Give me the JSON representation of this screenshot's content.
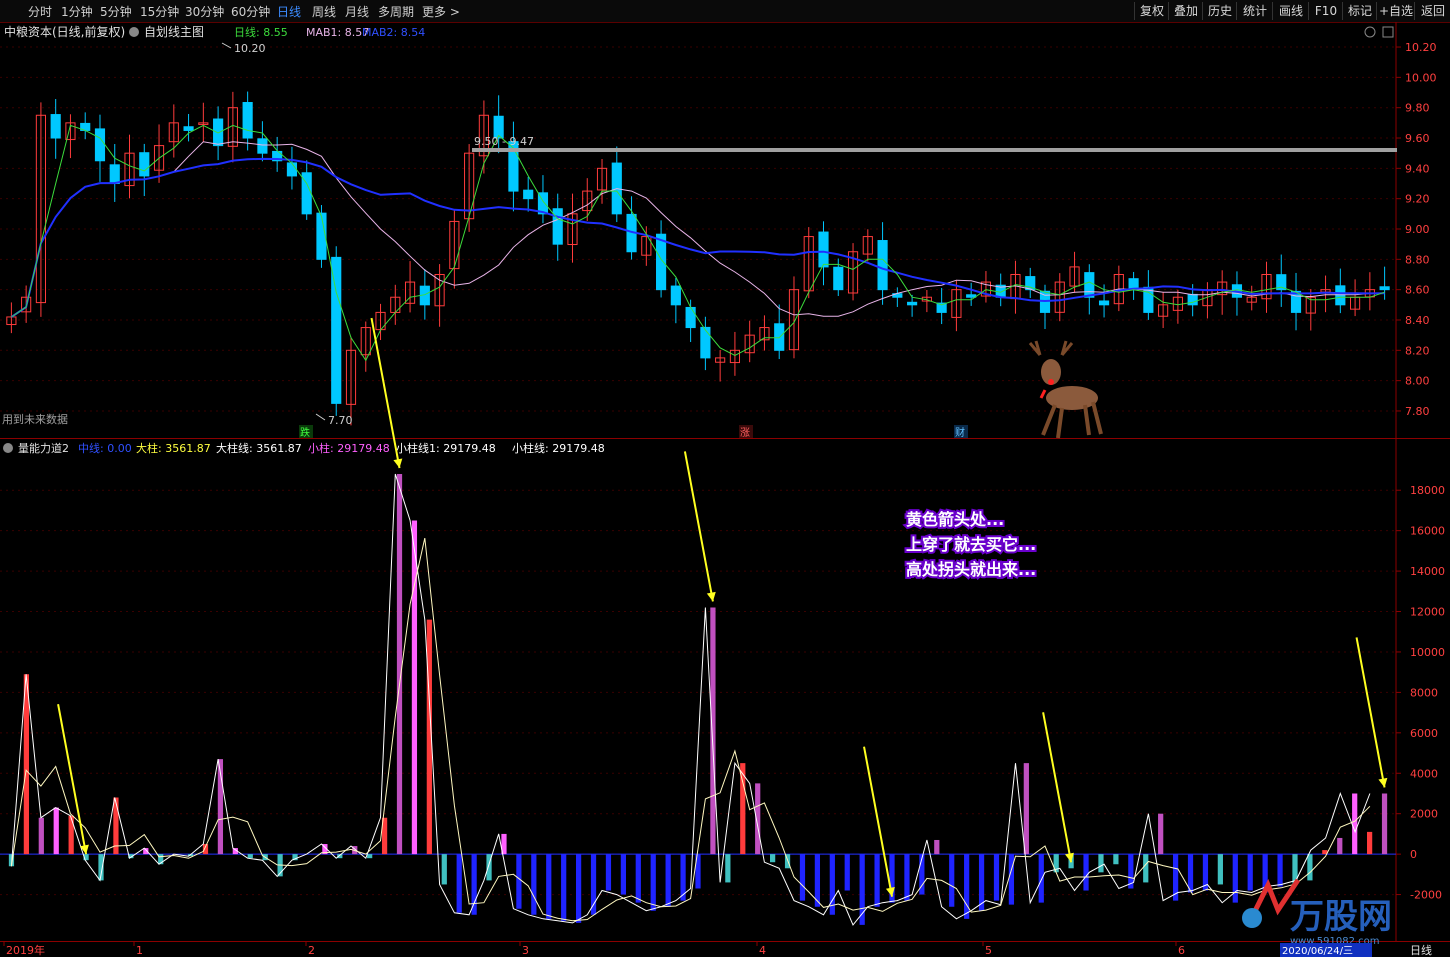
{
  "toolbar": {
    "left": [
      "分时",
      "1分钟",
      "5分钟",
      "15分钟",
      "30分钟",
      "60分钟",
      "日线",
      "周线",
      "月线",
      "多周期",
      "更多 >"
    ],
    "active": "日线",
    "right": [
      "复权",
      "叠加",
      "历史",
      "统计",
      "画线",
      "F10",
      "标记",
      "+自选",
      "返回"
    ]
  },
  "main_header": {
    "title": "中粮资本(日线,前复权)",
    "menu": "自划线主图",
    "day": "日线: 8.55",
    "mab1": "MAB1: 8.57",
    "mab2": "MAB2: 8.54"
  },
  "sub_header": {
    "title": "量能力道2",
    "zhongxian": "中线: 0.00",
    "dazhu": "大柱: 3561.87",
    "dazhuxian": "大柱线: 3561.87",
    "xiaozhu": "小柱: 29179.48",
    "xiaozhuxian1": "小柱线1: 29179.48",
    "xiaozhuxian": "小柱线: 29179.48"
  },
  "annotations": {
    "high": "10.20",
    "low": "7.70",
    "range": "9.50 - 9.47",
    "future": "用到未来数据",
    "die": "跌",
    "zhang": "涨",
    "cai": "财",
    "callout": [
      "黄色箭头处...",
      "上穿了就去买它...",
      "高处拐头就出来..."
    ],
    "watermark": "万股网",
    "watermark_url": "www.591082.com"
  },
  "bottom_axis": {
    "labels": [
      "2019年",
      "1",
      "2",
      "3",
      "4",
      "5",
      "6"
    ],
    "date_box": "2020/06/24/三",
    "period": "日线"
  },
  "colors": {
    "up": "#ff3c3c",
    "down": "#00c8ff",
    "ma_green": "#3cdc3c",
    "ma_pink": "#e8b4e8",
    "ma_blue": "#2030ff",
    "arrow": "#ffff20",
    "grid": "#8b0000",
    "bar_neg": "#1f24ff"
  },
  "chart_data": [
    {
      "type": "candlestick",
      "title": "中粮资本(日线,前复权)",
      "ylim": [
        7.7,
        10.25
      ],
      "yticks": [
        7.8,
        8.0,
        8.2,
        8.4,
        8.6,
        8.8,
        9.0,
        9.2,
        9.4,
        9.6,
        9.8,
        10.0,
        10.2
      ],
      "close": [
        8.42,
        8.55,
        9.75,
        9.6,
        9.7,
        9.65,
        9.45,
        9.3,
        9.5,
        9.35,
        9.55,
        9.7,
        9.65,
        9.7,
        9.55,
        9.8,
        9.6,
        9.5,
        9.45,
        9.35,
        9.1,
        8.8,
        7.85,
        8.2,
        8.35,
        8.45,
        8.55,
        8.65,
        8.5,
        8.7,
        9.05,
        9.5,
        9.75,
        9.6,
        9.25,
        9.2,
        9.1,
        8.9,
        9.1,
        9.25,
        9.4,
        9.1,
        8.85,
        8.95,
        8.6,
        8.5,
        8.35,
        8.15,
        8.15,
        8.2,
        8.3,
        8.35,
        8.2,
        8.6,
        8.95,
        8.75,
        8.6,
        8.85,
        8.95,
        8.6,
        8.55,
        8.5,
        8.55,
        8.45,
        8.6,
        8.55,
        8.65,
        8.55,
        8.7,
        8.6,
        8.45,
        8.65,
        8.75,
        8.55,
        8.5,
        8.7,
        8.6,
        8.45,
        8.5,
        8.55,
        8.5,
        8.6,
        8.65,
        8.55,
        8.55,
        8.7,
        8.6,
        8.45,
        8.55,
        8.6,
        8.5,
        8.55,
        8.6,
        8.6
      ],
      "series": [
        {
          "name": "MAB1",
          "color": "#3cdc3c"
        },
        {
          "name": "MAB2",
          "color": "#2030ff"
        },
        {
          "name": "日线",
          "color": "#e8b4e8"
        }
      ]
    },
    {
      "type": "bar",
      "title": "量能力道2",
      "ylim": [
        -4000,
        19000
      ],
      "yticks": [
        -2000,
        0,
        2000,
        4000,
        6000,
        8000,
        10000,
        12000,
        14000,
        16000,
        18000
      ],
      "values": [
        -600,
        8900,
        1800,
        2300,
        1900,
        -300,
        -1300,
        2800,
        -200,
        300,
        -500,
        0,
        -100,
        500,
        4700,
        300,
        -200,
        -300,
        -1100,
        -300,
        0,
        500,
        -200,
        400,
        -200,
        1800,
        18800,
        16500,
        11600,
        -1500,
        -2900,
        -3000,
        -1300,
        1000,
        -2700,
        -3000,
        -3200,
        -3300,
        -3400,
        -3000,
        -1800,
        -2000,
        -2400,
        -2800,
        -2600,
        -2300,
        -1700,
        12200,
        -1400,
        4500,
        3500,
        -400,
        -700,
        -2300,
        -2600,
        -3000,
        -1800,
        -3500,
        -2600,
        -2400,
        -2300,
        -2000,
        700,
        -2600,
        -3200,
        -2800,
        -2300,
        -2500,
        4500,
        -2400,
        -900,
        -700,
        -1800,
        -900,
        -500,
        -1700,
        -1400,
        2000,
        -2300,
        -1900,
        -1800,
        -1500,
        -2400,
        -1800,
        -1900,
        -1600,
        -1500,
        -1300,
        200,
        800,
        3000,
        1100,
        3000
      ],
      "arrows_at": [
        5,
        26,
        47,
        59,
        71,
        93
      ]
    }
  ]
}
